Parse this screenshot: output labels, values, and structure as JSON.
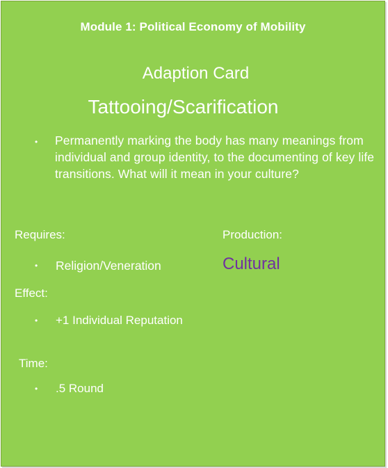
{
  "card": {
    "module_title": "Module 1: Political Economy of Mobility",
    "card_type": "Adaption Card",
    "card_name": "Tattooing/Scarification",
    "description": "Permanently marking the body has many meanings from individual and group identity, to the documenting of key life transitions.  What will it mean in your culture?",
    "requires": {
      "label": "Requires:",
      "value": "Religion/Veneration"
    },
    "production": {
      "label": "Production:",
      "value": "Cultural"
    },
    "effect": {
      "label": "Effect:",
      "value": "+1 Individual Reputation"
    },
    "time": {
      "label": "Time:",
      "value": ".5 Round"
    },
    "bullet_glyph": "•"
  },
  "colors": {
    "card_background": "#92d050",
    "text": "#ffffff",
    "production_value": "#7030a0"
  }
}
